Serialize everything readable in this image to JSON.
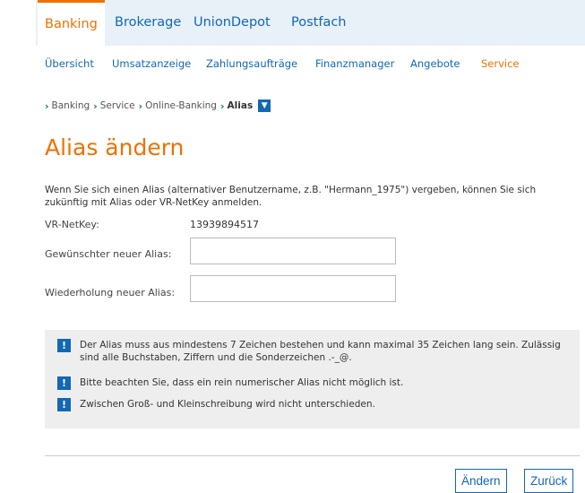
{
  "topnav": {
    "tabs": [
      {
        "label": "Banking"
      },
      {
        "label": "Brokerage"
      },
      {
        "label": "UnionDepot"
      },
      {
        "label": "Postfach"
      }
    ]
  },
  "subnav": {
    "items": [
      {
        "label": "Übersicht"
      },
      {
        "label": "Umsatzanzeige"
      },
      {
        "label": "Zahlungsaufträge"
      },
      {
        "label": "Finanzmanager"
      },
      {
        "label": "Angebote"
      },
      {
        "label": "Service"
      }
    ]
  },
  "breadcrumb": {
    "items": [
      {
        "label": "Banking"
      },
      {
        "label": "Service"
      },
      {
        "label": "Online-Banking"
      },
      {
        "label": "Alias"
      }
    ]
  },
  "page": {
    "title": "Alias ändern",
    "intro": "Wenn Sie sich einen Alias (alternativer Benutzername, z.B. \"Hermann_1975\") vergeben, können Sie sich zukünftig mit Alias oder VR-NetKey anmelden."
  },
  "form": {
    "netkey_label": "VR-NetKey:",
    "netkey_value": "13939894517",
    "new_alias_label": "Gewünschter neuer Alias:",
    "new_alias_value": "",
    "repeat_alias_label": "Wiederholung neuer Alias:",
    "repeat_alias_value": ""
  },
  "info": {
    "items": [
      "Der Alias muss aus mindestens 7 Zeichen bestehen und kann maximal 35 Zeichen lang sein. Zulässig sind alle Buchstaben, Ziffern und die Sonderzeichen .-_@.",
      "Bitte beachten Sie, dass ein rein numerischer Alias nicht möglich ist.",
      "Zwischen Groß- und Kleinschreibung wird nicht unterschieden."
    ]
  },
  "buttons": {
    "change_label": "Ändern",
    "back_label": "Zurück"
  },
  "colors": {
    "accent": "#ee7100",
    "link": "#1268b3",
    "nav_bg": "#e8f0f8",
    "info_bg": "#eeeeee"
  }
}
